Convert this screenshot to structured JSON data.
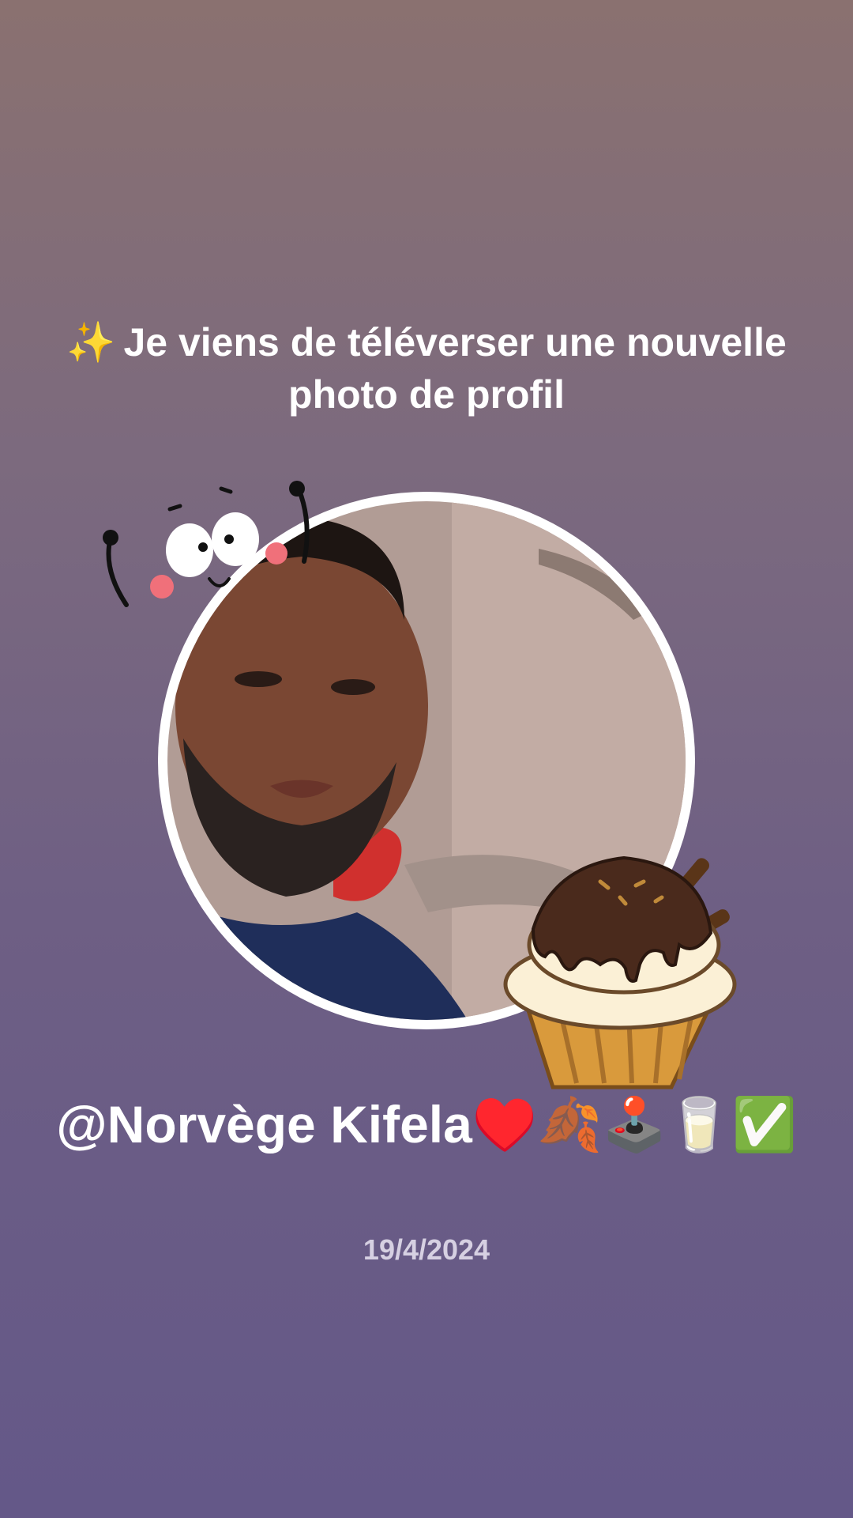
{
  "headline": {
    "sparkle": "✨",
    "text": "Je viens de téléverser une nouvelle photo de profil"
  },
  "profile": {
    "photo_icon": "profile-photo",
    "username": "@Norvège Kifela♥️🍂🕹️🥛✅",
    "date": "19/4/2024"
  },
  "stickers": {
    "top_left": "cute-face-sticker-icon",
    "bottom_right": "cupcake-sticker-icon"
  },
  "colors": {
    "text": "#ffffff",
    "date_text": "#d6d0e2",
    "bg_top": "#8a7170",
    "bg_bottom": "#645888"
  }
}
